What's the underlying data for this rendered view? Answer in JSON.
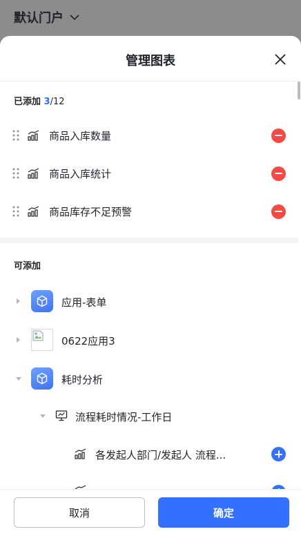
{
  "portal": {
    "title": "默认门户"
  },
  "sheet": {
    "title": "管理图表"
  },
  "added": {
    "label": "已添加",
    "count": "3",
    "total": "/12",
    "items": [
      {
        "label": "商品入库数量"
      },
      {
        "label": "商品入库统计"
      },
      {
        "label": "商品库存不足预警"
      }
    ]
  },
  "available": {
    "label": "可添加",
    "apps": [
      {
        "label": "应用-表单",
        "expanded": false
      },
      {
        "label": "0622应用3",
        "expanded": false
      },
      {
        "label": "耗时分析",
        "expanded": true
      }
    ],
    "group": {
      "label": "流程耗时情况-工作日",
      "expanded": true
    },
    "charts": [
      {
        "label": "各发起人部门/发起人 流程..."
      }
    ]
  },
  "footer": {
    "cancel_label": "取消",
    "ok_label": "确定"
  },
  "colors": {
    "primary": "#3370ff",
    "danger": "#f54a45",
    "overlay": "#8c8c8c"
  }
}
